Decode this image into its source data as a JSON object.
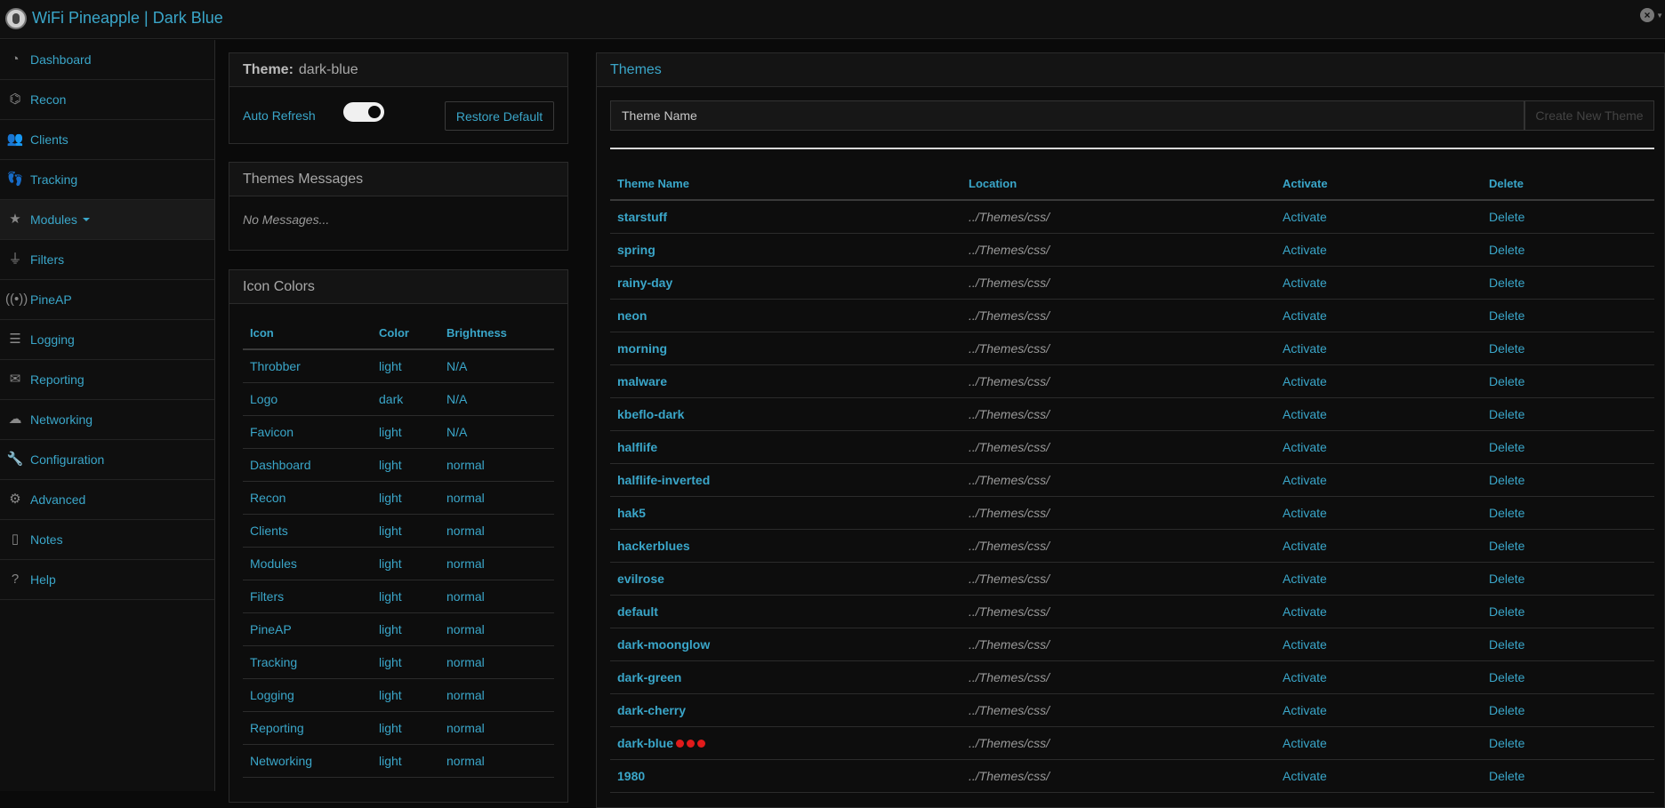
{
  "app": {
    "title": "WiFi Pineapple | Dark Blue",
    "logo_icon": "pineapple-logo-icon",
    "close_icon": "close-circle-icon"
  },
  "sidebar": {
    "items": [
      {
        "label": "Dashboard",
        "icon": "speedometer-icon"
      },
      {
        "label": "Recon",
        "icon": "binoculars-icon"
      },
      {
        "label": "Clients",
        "icon": "users-icon"
      },
      {
        "label": "Tracking",
        "icon": "footprints-icon"
      },
      {
        "label": "Modules",
        "icon": "star-icon"
      },
      {
        "label": "Filters",
        "icon": "filter-icon"
      },
      {
        "label": "PineAP",
        "icon": "antenna-icon"
      },
      {
        "label": "Logging",
        "icon": "document-list-icon"
      },
      {
        "label": "Reporting",
        "icon": "envelope-chart-icon"
      },
      {
        "label": "Networking",
        "icon": "cloud-network-icon"
      },
      {
        "label": "Configuration",
        "icon": "wrench-icon"
      },
      {
        "label": "Advanced",
        "icon": "gears-icon"
      },
      {
        "label": "Notes",
        "icon": "notepad-icon"
      },
      {
        "label": "Help",
        "icon": "question-circle-icon"
      }
    ]
  },
  "theme_panel": {
    "label": "Theme:",
    "value": "dark-blue",
    "auto_refresh": "Auto Refresh",
    "restore_button": "Restore Default"
  },
  "messages_panel": {
    "title": "Themes Messages",
    "empty": "No Messages..."
  },
  "icon_colors": {
    "title": "Icon Colors",
    "headers": [
      "Icon",
      "Color",
      "Brightness"
    ],
    "rows": [
      [
        "Throbber",
        "light",
        "N/A"
      ],
      [
        "Logo",
        "dark",
        "N/A"
      ],
      [
        "Favicon",
        "light",
        "N/A"
      ],
      [
        "Dashboard",
        "light",
        "normal"
      ],
      [
        "Recon",
        "light",
        "normal"
      ],
      [
        "Clients",
        "light",
        "normal"
      ],
      [
        "Modules",
        "light",
        "normal"
      ],
      [
        "Filters",
        "light",
        "normal"
      ],
      [
        "PineAP",
        "light",
        "normal"
      ],
      [
        "Tracking",
        "light",
        "normal"
      ],
      [
        "Logging",
        "light",
        "normal"
      ],
      [
        "Reporting",
        "light",
        "normal"
      ],
      [
        "Networking",
        "light",
        "normal"
      ]
    ]
  },
  "themes": {
    "title": "Themes",
    "input_placeholder": "Theme Name",
    "create_button": "Create New Theme",
    "headers": [
      "Theme Name",
      "Location",
      "Activate",
      "Delete"
    ],
    "rows": [
      {
        "name": "starstuff",
        "location": "../Themes/css/",
        "activate": "Activate",
        "delete": "Delete"
      },
      {
        "name": "spring",
        "location": "../Themes/css/",
        "activate": "Activate",
        "delete": "Delete"
      },
      {
        "name": "rainy-day",
        "location": "../Themes/css/",
        "activate": "Activate",
        "delete": "Delete"
      },
      {
        "name": "neon",
        "location": "../Themes/css/",
        "activate": "Activate",
        "delete": "Delete"
      },
      {
        "name": "morning",
        "location": "../Themes/css/",
        "activate": "Activate",
        "delete": "Delete"
      },
      {
        "name": "malware",
        "location": "../Themes/css/",
        "activate": "Activate",
        "delete": "Delete"
      },
      {
        "name": "kbeflo-dark",
        "location": "../Themes/css/",
        "activate": "Activate",
        "delete": "Delete"
      },
      {
        "name": "halflife",
        "location": "../Themes/css/",
        "activate": "Activate",
        "delete": "Delete"
      },
      {
        "name": "halflife-inverted",
        "location": "../Themes/css/",
        "activate": "Activate",
        "delete": "Delete"
      },
      {
        "name": "hak5",
        "location": "../Themes/css/",
        "activate": "Activate",
        "delete": "Delete"
      },
      {
        "name": "hackerblues",
        "location": "../Themes/css/",
        "activate": "Activate",
        "delete": "Delete"
      },
      {
        "name": "evilrose",
        "location": "../Themes/css/",
        "activate": "Activate",
        "delete": "Delete"
      },
      {
        "name": "default",
        "location": "../Themes/css/",
        "activate": "Activate",
        "delete": "Delete"
      },
      {
        "name": "dark-moonglow",
        "location": "../Themes/css/",
        "activate": "Activate",
        "delete": "Delete"
      },
      {
        "name": "dark-green",
        "location": "../Themes/css/",
        "activate": "Activate",
        "delete": "Delete"
      },
      {
        "name": "dark-cherry",
        "location": "../Themes/css/",
        "activate": "Activate",
        "delete": "Delete"
      },
      {
        "name": "dark-blue",
        "location": "../Themes/css/",
        "activate": "Activate",
        "delete": "Delete",
        "current": true
      },
      {
        "name": "1980",
        "location": "../Themes/css/",
        "activate": "Activate",
        "delete": "Delete"
      }
    ]
  },
  "colors": {
    "accent": "#3aa6c9",
    "background": "#0a0a0a",
    "active_dot": "#e01b1b"
  }
}
